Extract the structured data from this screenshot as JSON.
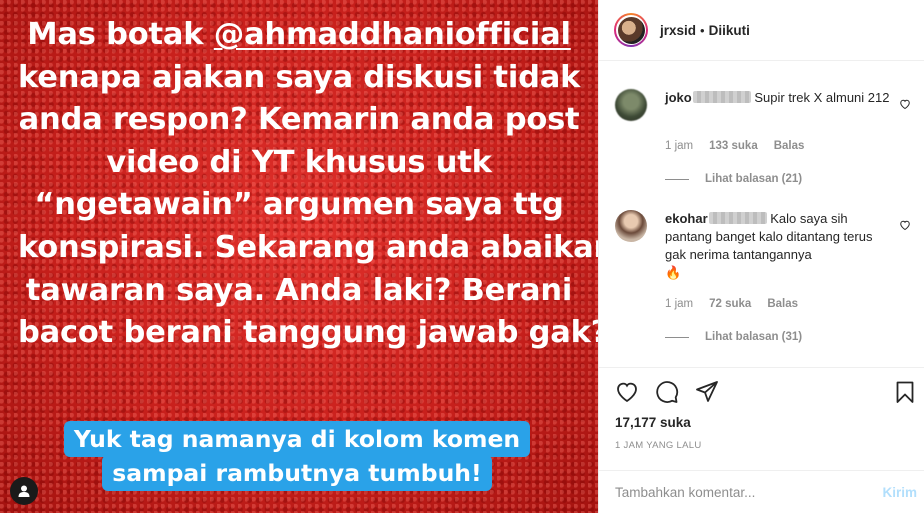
{
  "media": {
    "story_lines": [
      {
        "prefix": "Mas botak ",
        "mention": "@ahmaddhaniofficial"
      },
      "kenapa ajakan saya diskusi tidak",
      "anda respon? Kemarin anda post",
      "video di YT khusus utk",
      "“ngetawain” argumen saya ttg",
      "konspirasi. Sekarang anda abaikan",
      "tawaran saya. Anda laki? Berani",
      "bacot berani tanggung jawab gak?"
    ],
    "cta_lines": [
      "Yuk tag namanya di kolom komen",
      "sampai rambutnya tumbuh!"
    ],
    "background_color": "#c8201c",
    "cta_color": "#2aa2e8"
  },
  "header": {
    "username": "jrxsid",
    "separator": "•",
    "follow_status": "Diikuti"
  },
  "comments": [
    {
      "username": "joko",
      "text": "Supir trek X almuni 212",
      "time": "1 jam",
      "likes": "133 suka",
      "reply_label": "Balas",
      "view_replies": "Lihat balasan (21)"
    },
    {
      "username": "ekohar",
      "text": "Kalo saya sih pantang banget kalo ditantang terus gak nerima tantangannya",
      "emoji": "🔥",
      "time": "1 jam",
      "likes": "72 suka",
      "reply_label": "Balas",
      "view_replies": "Lihat balasan (31)"
    }
  ],
  "actions": {
    "like_count": "17,177 suka",
    "posted_time": "1 JAM YANG LALU",
    "comment_placeholder": "Tambahkan komentar...",
    "post_label": "Kirim",
    "post_label_color": "#b2dffc"
  },
  "icons": [
    "heart-icon",
    "comment-icon",
    "share-icon",
    "bookmark-icon",
    "user-tag-icon"
  ]
}
